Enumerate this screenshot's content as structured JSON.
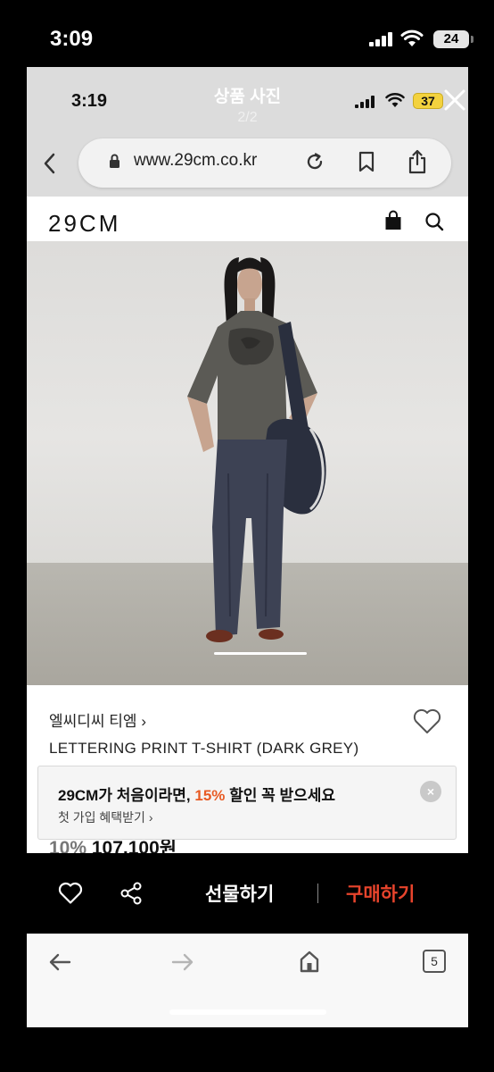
{
  "outer_status": {
    "time": "3:09",
    "battery": "24"
  },
  "inner_status": {
    "time": "3:19",
    "battery": "37"
  },
  "viewer": {
    "title": "상품 사진",
    "counter": "2/2"
  },
  "browser": {
    "url": "www.29cm.co.kr"
  },
  "site": {
    "logo": "29CM"
  },
  "product": {
    "brand": "엘씨디씨 티엠",
    "brand_chevron": "›",
    "name": "LETTERING PRINT T-SHIRT (DARK GREY)",
    "discount": "10%",
    "price": "107,100원"
  },
  "promo": {
    "line1_prefix": "29CM가 처음이라면, ",
    "line1_accent": "15%",
    "line1_suffix": " 할인 꼭 받으세요",
    "line2": "첫 가입 혜택받기 ›",
    "close": "×"
  },
  "actions": {
    "gift": "선물하기",
    "buy": "구매하기"
  },
  "safari": {
    "tab_count": "5"
  },
  "colors": {
    "accent_orange": "#e85b24",
    "buy_red": "#e8442c"
  }
}
